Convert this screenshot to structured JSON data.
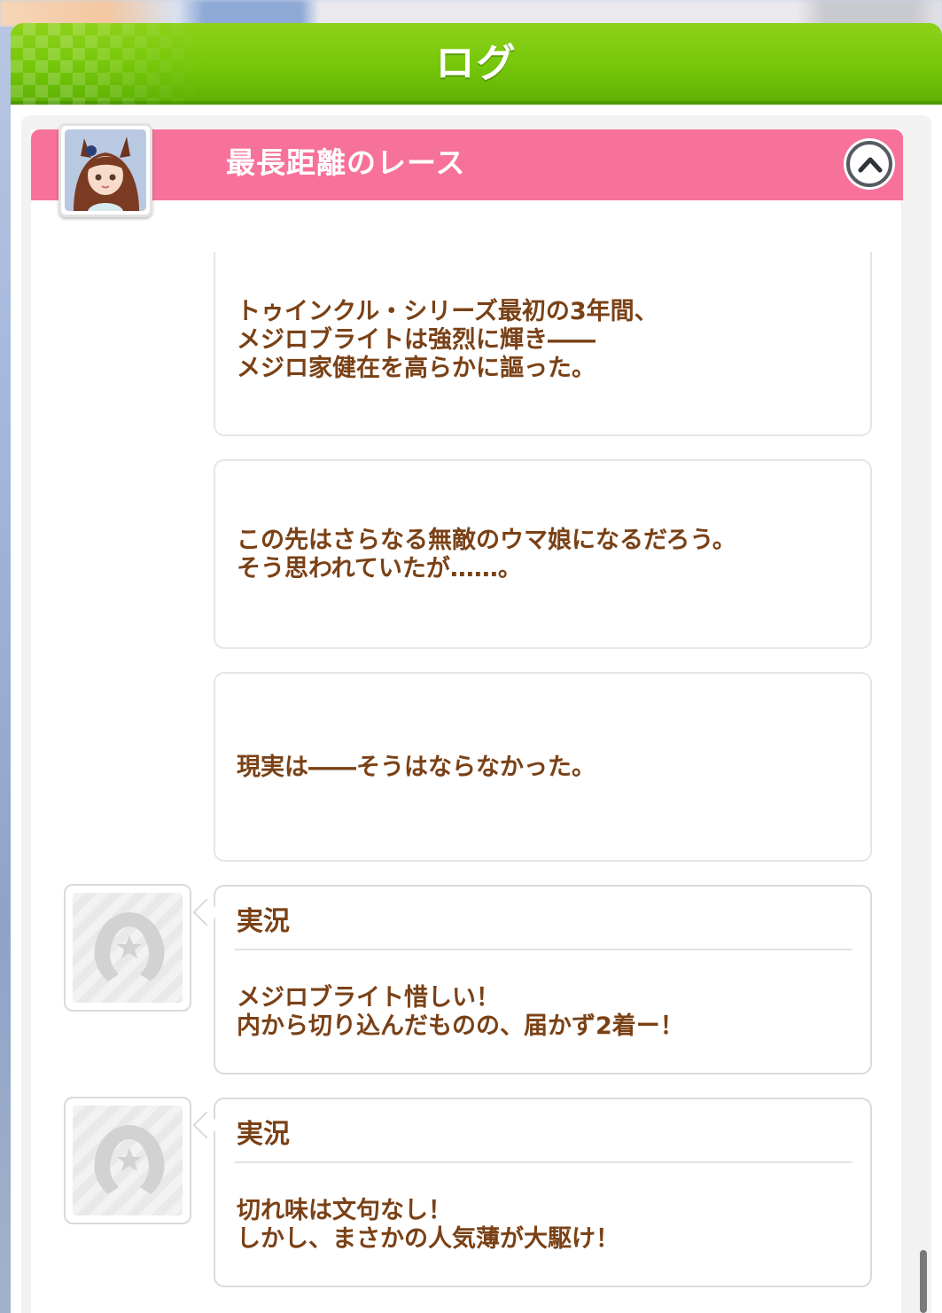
{
  "header": {
    "title": "ログ"
  },
  "chapter": {
    "title": "最長距離のレース",
    "collapse_icon": "chevron-up-icon"
  },
  "narration": [
    {
      "text": "トゥインクル・シリーズ最初の3年間、\nメジロブライトは強烈に輝き――\nメジロ家健在を高らかに謳った。"
    },
    {
      "text": "この先はさらなる無敵のウマ娘になるだろう。\nそう思われていたが……。"
    },
    {
      "text": "現実は――そうはならなかった。"
    }
  ],
  "speaker_messages": [
    {
      "speaker": "実況",
      "avatar_icon": "horseshoe-icon",
      "text": "メジロブライト惜しい！\n内から切り込んだものの、届かず2着ー！"
    },
    {
      "speaker": "実況",
      "avatar_icon": "horseshoe-icon",
      "text": "切れ味は文句なし！\nしかし、まさかの人気薄が大駆け！"
    }
  ],
  "colors": {
    "header_green": "#76c70a",
    "chapter_pink": "#f7729b",
    "text_brown": "#7a4116"
  }
}
